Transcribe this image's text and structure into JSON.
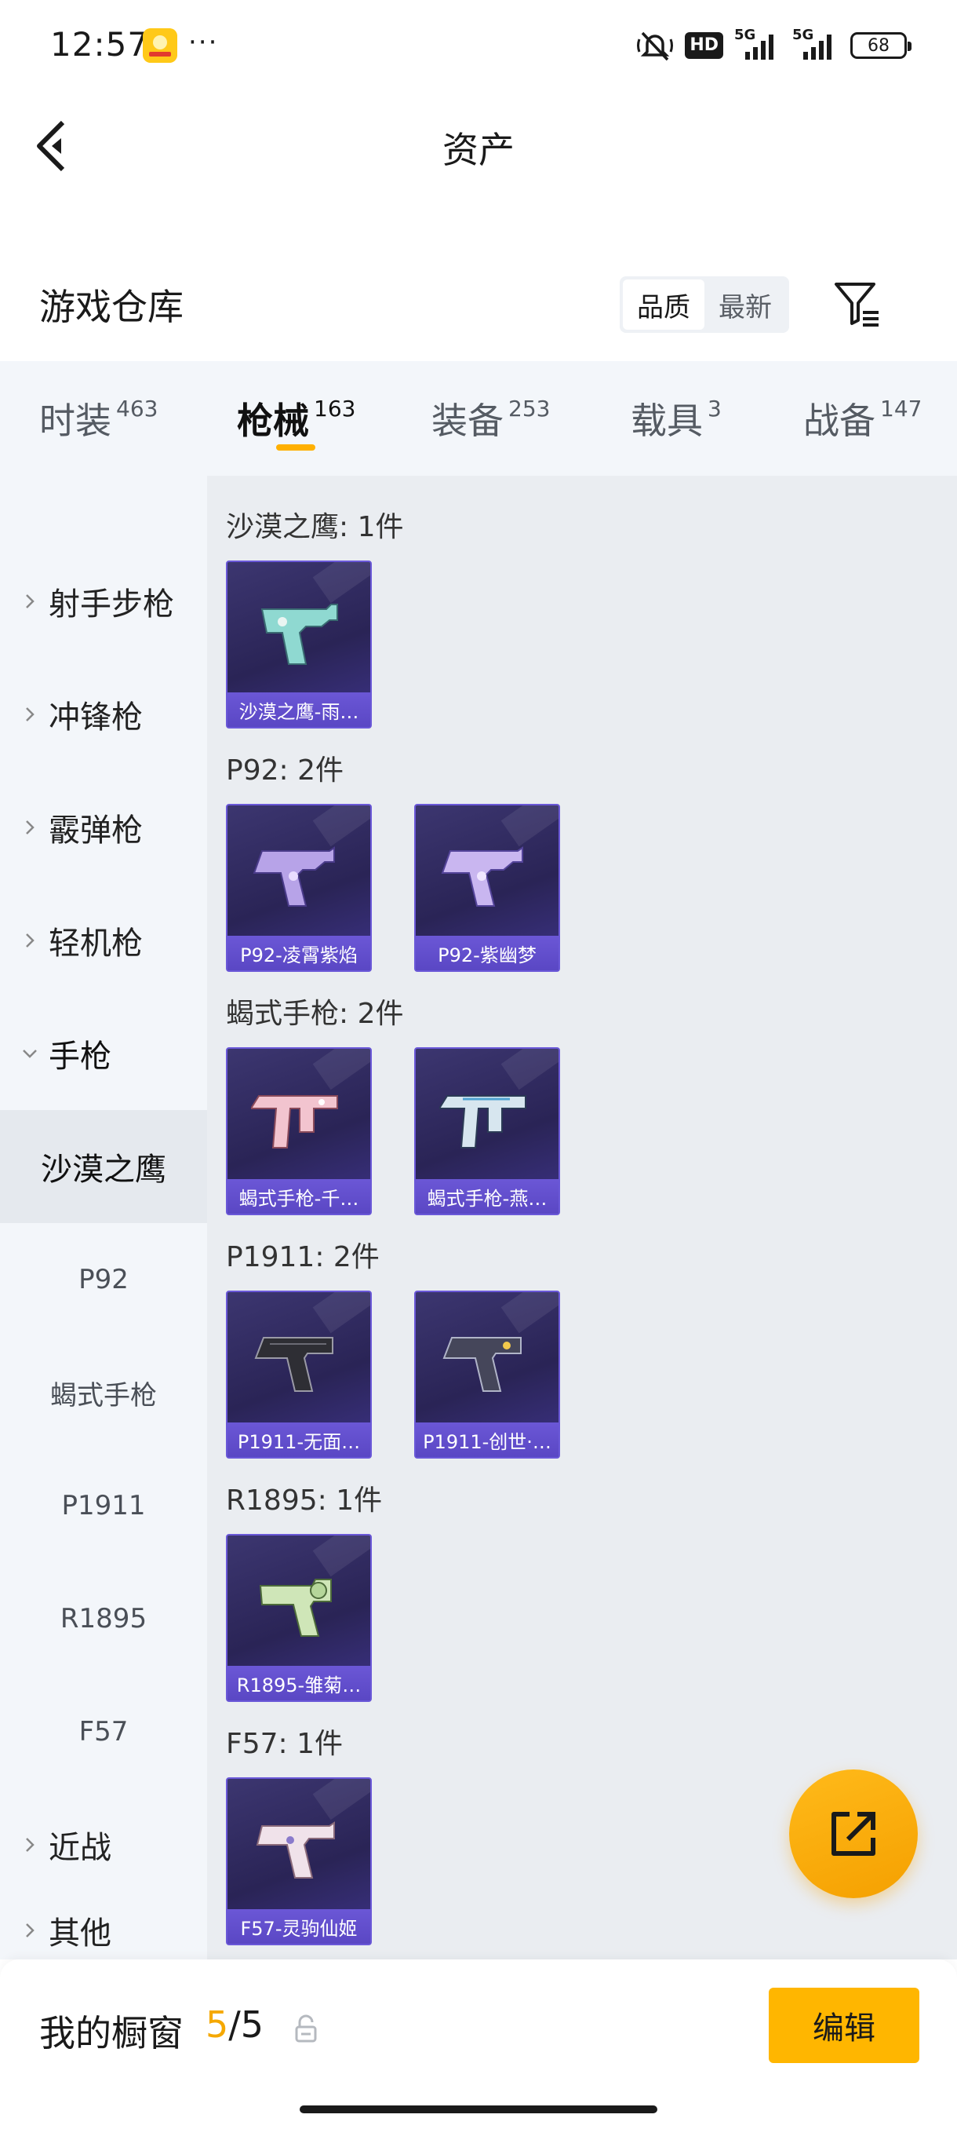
{
  "status_bar": {
    "time": "12:57",
    "more": "···",
    "hd": "HD",
    "network_1": "5G",
    "network_2": "5G",
    "battery": "68"
  },
  "nav": {
    "title": "资产"
  },
  "warehouse": {
    "title": "游戏仓库",
    "sort_options": [
      "品质",
      "最新"
    ],
    "sort_selected": "品质"
  },
  "tabs": [
    {
      "label": "时装",
      "count": "463"
    },
    {
      "label": "枪械",
      "count": "163"
    },
    {
      "label": "装备",
      "count": "253"
    },
    {
      "label": "载具",
      "count": "3"
    },
    {
      "label": "战备",
      "count": "147"
    }
  ],
  "sidebar": {
    "categories": [
      {
        "label": "射手步枪"
      },
      {
        "label": "冲锋枪"
      },
      {
        "label": "霰弹枪"
      },
      {
        "label": "轻机枪"
      },
      {
        "label": "手枪"
      },
      {
        "label": "近战"
      },
      {
        "label": "其他"
      }
    ],
    "subcategories": [
      {
        "label": "沙漠之鹰"
      },
      {
        "label": "P92"
      },
      {
        "label": "蝎式手枪"
      },
      {
        "label": "P1911"
      },
      {
        "label": "R1895"
      },
      {
        "label": "F57"
      }
    ]
  },
  "groups": [
    {
      "title": "沙漠之鹰: 1件",
      "items": [
        {
          "label": "沙漠之鹰-雨…"
        }
      ]
    },
    {
      "title": "P92: 2件",
      "items": [
        {
          "label": "P92-凌霄紫焰"
        },
        {
          "label": "P92-紫幽梦"
        }
      ]
    },
    {
      "title": "蝎式手枪: 2件",
      "items": [
        {
          "label": "蝎式手枪-千…"
        },
        {
          "label": "蝎式手枪-燕…"
        }
      ]
    },
    {
      "title": "P1911: 2件",
      "items": [
        {
          "label": "P1911-无面…"
        },
        {
          "label": "P1911-创世·…"
        }
      ]
    },
    {
      "title": "R1895: 1件",
      "items": [
        {
          "label": "R1895-雏菊…"
        }
      ]
    },
    {
      "title": "F57: 1件",
      "items": [
        {
          "label": "F57-灵驹仙姬"
        }
      ]
    }
  ],
  "bottom_bar": {
    "showcase_label": "我的橱窗",
    "showcase_current": "5",
    "showcase_sep": "/",
    "showcase_total": "5",
    "edit_label": "编辑"
  },
  "colors": {
    "accent": "#ffb600",
    "card_bg": "#2a2456",
    "card_label": "#6b57d6"
  }
}
